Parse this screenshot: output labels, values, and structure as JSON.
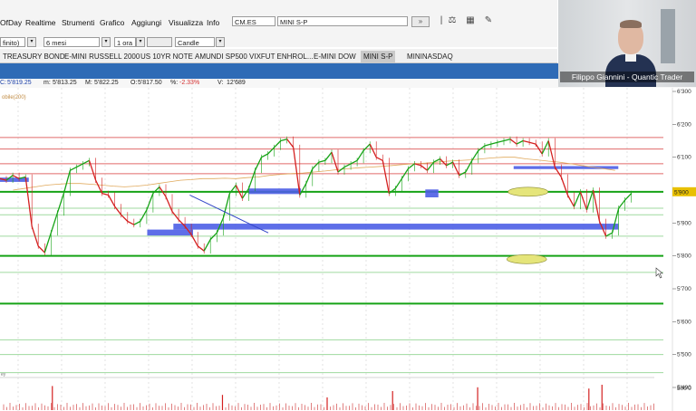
{
  "menu": {
    "items": [
      {
        "id": "ofday",
        "label": "OfDay"
      },
      {
        "id": "realtime",
        "label": "Realtime"
      },
      {
        "id": "strumenti",
        "label": "Strumenti"
      },
      {
        "id": "grafico",
        "label": "Grafico"
      },
      {
        "id": "aggiungi",
        "label": "Aggiungi"
      },
      {
        "id": "visualizza",
        "label": "Visualizza"
      },
      {
        "id": "info",
        "label": "Info"
      }
    ]
  },
  "symbol": {
    "code": "CM.ES",
    "name": "MINI S-P",
    "go_icon": "double-chevron-right-icon"
  },
  "toolbar_row": {
    "mode": "finito)",
    "period": "6 mesi",
    "timeframe": "1 ora",
    "blank": "",
    "chart_type": "Candle"
  },
  "tabs": [
    {
      "label": "TREASURY BOND",
      "active": false
    },
    {
      "label": "E-MINI RUSSELL 2000",
      "active": false
    },
    {
      "label": "US 10YR NOTE",
      "active": false
    },
    {
      "label": "AMUNDI SP500 VIXFUT ENHROL...",
      "active": false
    },
    {
      "label": "E-MINI DOW",
      "active": false
    },
    {
      "label": "MINI S-P",
      "active": true
    },
    {
      "label": "MININASDAQ",
      "active": false
    }
  ],
  "ohlc": {
    "c_label": "C:",
    "c_value": "5'819.25",
    "m_label": "m:",
    "m_value": "5'813.25",
    "max_label": "M:",
    "max_value": "5'822.25",
    "o_label": "O:",
    "o_value": "5'817.50",
    "pct_label": "%:",
    "pct_value": "-2.33%",
    "v_label": "V:",
    "v_value": "12'689"
  },
  "chart_data": {
    "type": "line",
    "indicator_label": "obile(200)",
    "volume_label": "ey",
    "current_price_tag": "5'900",
    "price_axis": {
      "ticks": [
        {
          "label": "6'300",
          "value": 6300
        },
        {
          "label": "6'200",
          "value": 6200
        },
        {
          "label": "6'100",
          "value": 6100
        },
        {
          "label": "6'000",
          "value": 6000
        },
        {
          "label": "5'900",
          "value": 5900
        },
        {
          "label": "5'800",
          "value": 5800
        },
        {
          "label": "5'700",
          "value": 5700
        },
        {
          "label": "5'600",
          "value": 5600
        },
        {
          "label": "5'500",
          "value": 5500
        },
        {
          "label": "5'400",
          "value": 5400
        }
      ],
      "ylim": [
        5400,
        6330
      ],
      "volume_tick": {
        "label": "500'0",
        "value": 500
      }
    },
    "horizontal_levels": [
      {
        "price": 6160,
        "color": "#e06a6a"
      },
      {
        "price": 6125,
        "color": "#e06a6a"
      },
      {
        "price": 6080,
        "color": "#e06a6a"
      },
      {
        "price": 6050,
        "color": "#e06a6a"
      },
      {
        "price": 5995,
        "color": "#16a316"
      },
      {
        "price": 5945,
        "color": "#9fd99f"
      },
      {
        "price": 5925,
        "color": "#9fd99f"
      },
      {
        "price": 5860,
        "color": "#9fd99f"
      },
      {
        "price": 5800,
        "color": "#16a316"
      },
      {
        "price": 5750,
        "color": "#9fd99f"
      },
      {
        "price": 5655,
        "color": "#16a316"
      },
      {
        "price": 5545,
        "color": "#9fd99f"
      },
      {
        "price": 5500,
        "color": "#9fd99f"
      },
      {
        "price": 5445,
        "color": "#9fd99f"
      }
    ],
    "price_series": [
      6035,
      6030,
      6045,
      6035,
      6040,
      5890,
      5830,
      5810,
      5870,
      5930,
      5990,
      6060,
      6070,
      6080,
      6090,
      6030,
      5990,
      5985,
      5950,
      5925,
      5905,
      5895,
      5905,
      5940,
      5990,
      6010,
      5980,
      5935,
      5910,
      5890,
      5865,
      5830,
      5815,
      5850,
      5870,
      5915,
      5990,
      6015,
      5975,
      6005,
      6060,
      6100,
      6110,
      6130,
      6150,
      6155,
      6130,
      5985,
      6020,
      6065,
      6085,
      6090,
      6115,
      6055,
      6070,
      6080,
      6090,
      6120,
      6140,
      6100,
      6090,
      5990,
      6005,
      6035,
      6065,
      6080,
      6075,
      6060,
      6085,
      6095,
      6075,
      6085,
      6045,
      6055,
      6090,
      6120,
      6135,
      6140,
      6145,
      6150,
      6155,
      6140,
      6150,
      6145,
      6140,
      6110,
      6150,
      6070,
      6040,
      5985,
      5950,
      5995,
      5940,
      6000,
      5905,
      5860,
      5870,
      5945,
      5970,
      5990
    ],
    "moving_average": [
      6000,
      6005,
      6010,
      6015,
      6018,
      6020,
      6020,
      6018,
      6015,
      6012,
      6010,
      6012,
      6015,
      6020,
      6025,
      6030,
      6032,
      6035,
      6035,
      6036,
      6035,
      6038,
      6040,
      6045,
      6048,
      6050,
      6052,
      6055,
      6058,
      6062,
      6065,
      6068,
      6070,
      6072,
      6075,
      6078,
      6080,
      6082,
      6085,
      6088,
      6090,
      6092,
      6095,
      6098,
      6100,
      6100,
      6095,
      6092,
      6088,
      6085,
      6080,
      6075,
      6070,
      6065,
      6060
    ],
    "volume_spikes": [
      {
        "x": 0.08,
        "h": 0.95
      },
      {
        "x": 0.34,
        "h": 0.6
      },
      {
        "x": 0.5,
        "h": 0.5
      },
      {
        "x": 0.6,
        "h": 0.75
      },
      {
        "x": 0.73,
        "h": 0.9
      },
      {
        "x": 0.9,
        "h": 0.85
      },
      {
        "x": 0.92,
        "h": 1.0
      }
    ],
    "zones": [
      {
        "label": "",
        "price_top": 6038,
        "price_bottom": 6025,
        "x0": 0.0,
        "x1": 0.044,
        "color": "#4c5ee6"
      },
      {
        "label": "",
        "price_top": 6005,
        "price_bottom": 5988,
        "x0": 0.38,
        "x1": 0.46,
        "color": "#4c5ee6"
      },
      {
        "label": "",
        "price_top": 6002,
        "price_bottom": 5978,
        "x0": 0.65,
        "x1": 0.67,
        "color": "#4c5ee6"
      },
      {
        "label": "",
        "price_top": 5880,
        "price_bottom": 5862,
        "x0": 0.225,
        "x1": 0.295,
        "color": "#4c5ee6"
      },
      {
        "label": "",
        "price_top": 5898,
        "price_bottom": 5880,
        "x0": 0.265,
        "x1": 0.945,
        "color": "#4c5ee6"
      },
      {
        "label": "",
        "price_top": 6073,
        "price_bottom": 6064,
        "x0": 0.785,
        "x1": 0.945,
        "color": "#4c5ee6"
      }
    ],
    "ellipses": [
      {
        "price": 5995,
        "x": 0.807,
        "color": "#e5e57a"
      },
      {
        "price": 5790,
        "x": 0.805,
        "color": "#e5e57a"
      }
    ],
    "trendline": {
      "x0": 0.29,
      "p0": 5985,
      "x1": 0.41,
      "p1": 5870,
      "color": "#3346c8"
    }
  },
  "webcam": {
    "caption": "Filippo Giannini - Quantic Trader"
  }
}
